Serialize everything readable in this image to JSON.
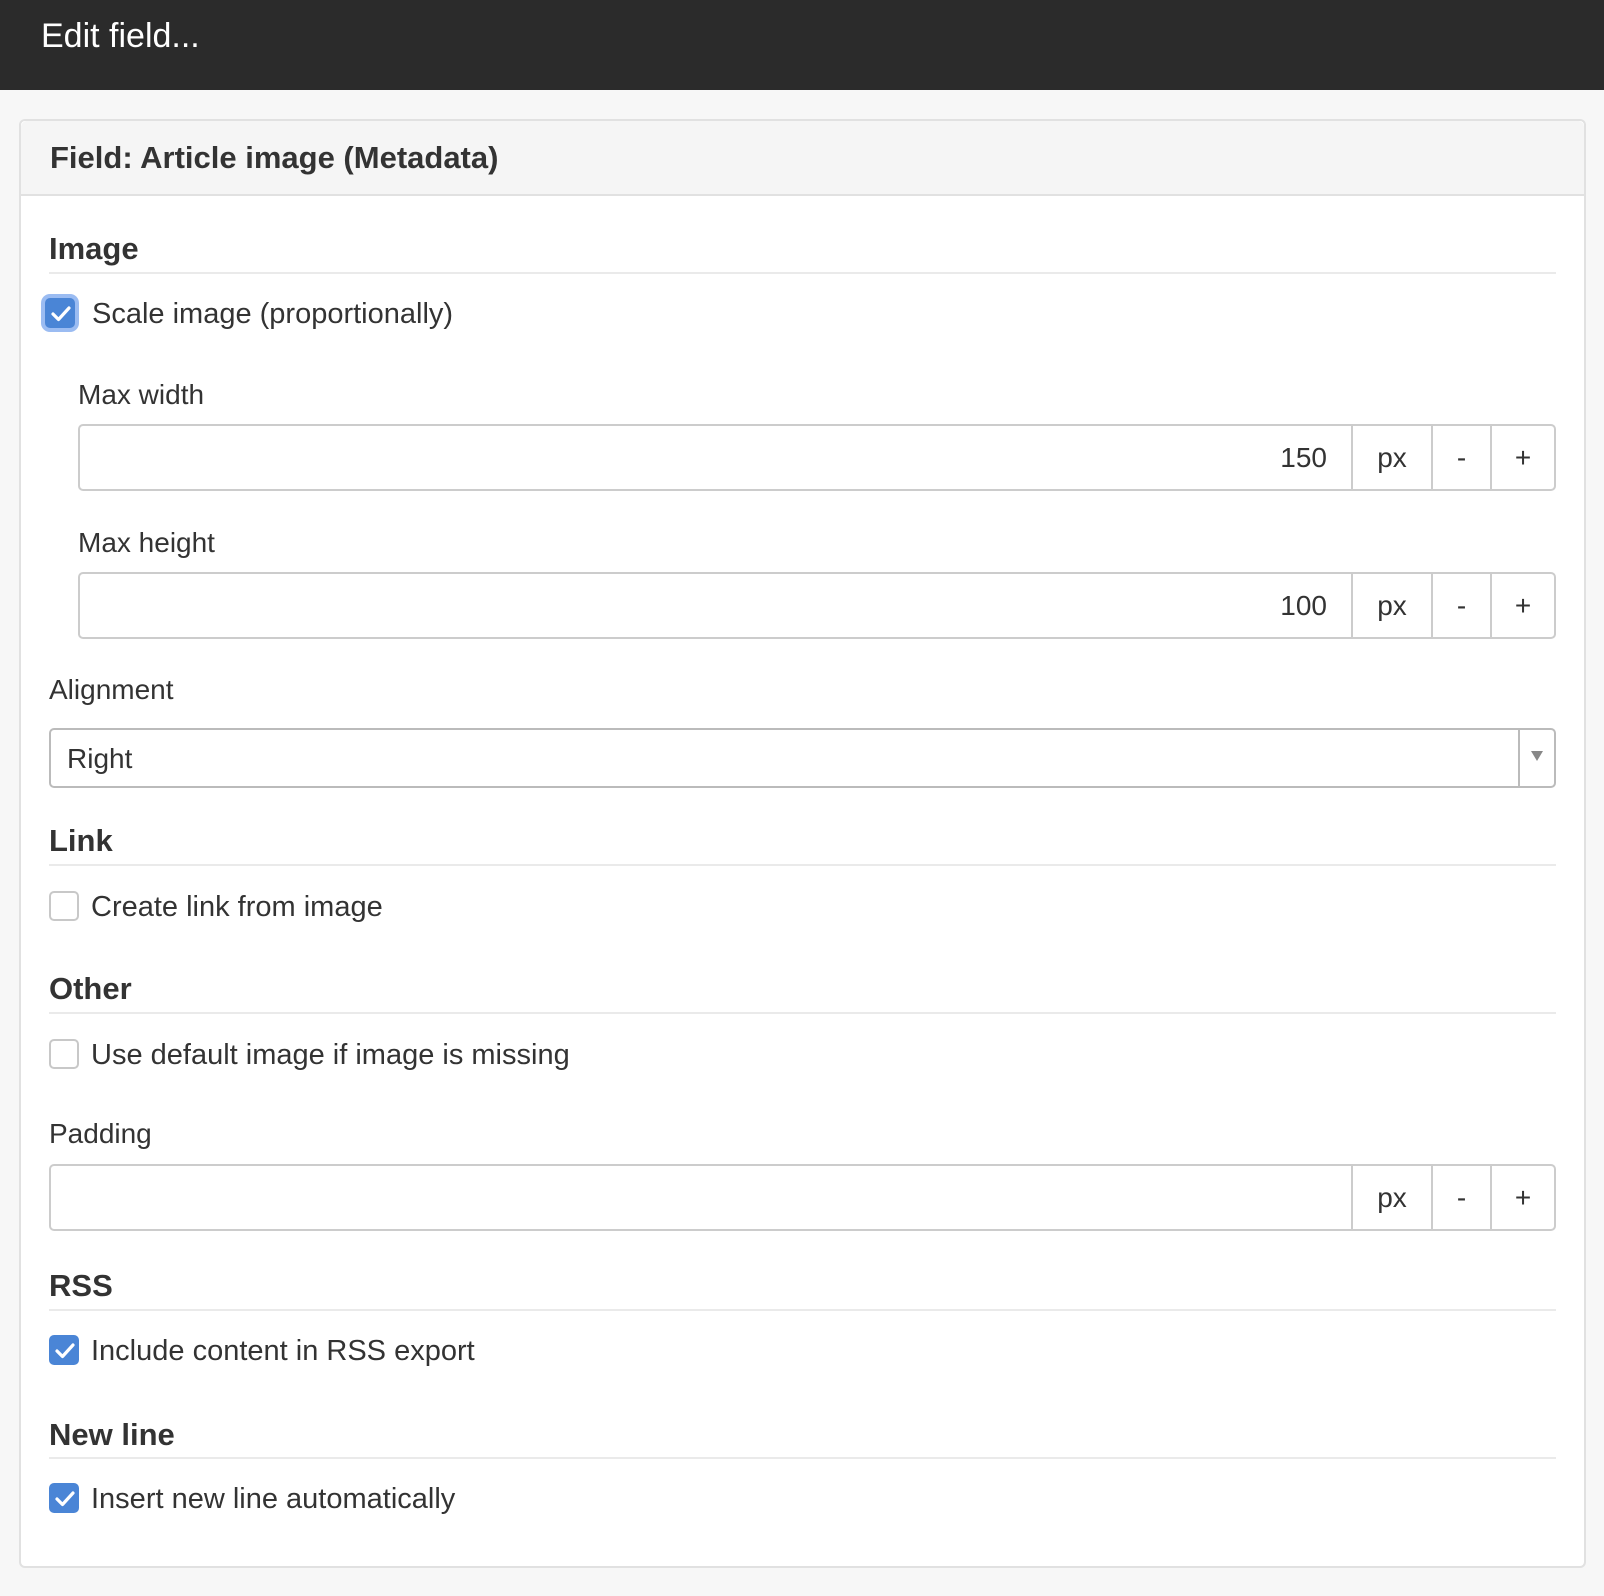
{
  "window": {
    "title": "Edit field..."
  },
  "panel": {
    "title": "Field: Article image (Metadata)"
  },
  "image_section": {
    "title": "Image",
    "scale_checkbox": {
      "label": "Scale image (proportionally)",
      "checked": true,
      "focused": true
    },
    "max_width": {
      "label": "Max width",
      "value": "150",
      "unit": "px",
      "decrement_label": "-",
      "increment_label": "+"
    },
    "max_height": {
      "label": "Max height",
      "value": "100",
      "unit": "px",
      "decrement_label": "-",
      "increment_label": "+"
    },
    "alignment": {
      "label": "Alignment",
      "selected": "Right"
    }
  },
  "link_section": {
    "title": "Link",
    "create_link_checkbox": {
      "label": "Create link from image",
      "checked": false
    }
  },
  "other_section": {
    "title": "Other",
    "default_image_checkbox": {
      "label": "Use default image if image is missing",
      "checked": false
    },
    "padding": {
      "label": "Padding",
      "value": "",
      "unit": "px",
      "decrement_label": "-",
      "increment_label": "+"
    }
  },
  "rss_section": {
    "title": "RSS",
    "include_rss_checkbox": {
      "label": "Include content in RSS export",
      "checked": true
    }
  },
  "newline_section": {
    "title": "New line",
    "insert_newline_checkbox": {
      "label": "Insert new line automatically",
      "checked": true
    }
  },
  "colors": {
    "topbar": "#2b2b2b",
    "checkbox_checked": "#4a85d6",
    "focus_ring": "#9bbcf2"
  }
}
